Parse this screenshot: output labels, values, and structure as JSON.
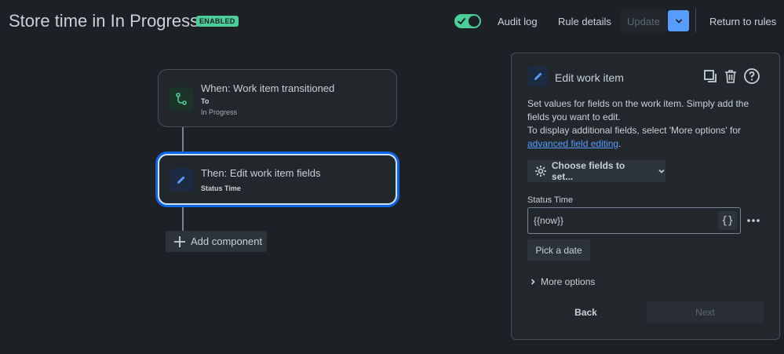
{
  "header": {
    "title": "Store time in In Progress",
    "badge": "ENABLED",
    "audit_log": "Audit log",
    "rule_details": "Rule details",
    "update": "Update",
    "return": "Return to rules"
  },
  "canvas": {
    "trigger": {
      "title": "When: Work item transitioned",
      "sub1": "To",
      "sub2": "In Progress",
      "icon": "transition-icon"
    },
    "action": {
      "title": "Then: Edit work item fields",
      "sub1": "Status Time",
      "icon": "pencil-icon"
    },
    "add_component": "Add component"
  },
  "panel": {
    "title": "Edit work item",
    "desc_line1": "Set values for fields on the work item. Simply add the fields you want to edit.",
    "desc_line2": "To display additional fields, select 'More options' for ",
    "desc_link": "advanced field editing",
    "desc_end": ".",
    "choose_fields": "Choose fields to set...",
    "field_label": "Status Time",
    "field_value": "{{now}}",
    "braces": "{}",
    "pick_date": "Pick a date",
    "more_options": "More options",
    "back": "Back",
    "next": "Next"
  },
  "colors": {
    "background": "#1d2125",
    "accent_blue": "#579dff",
    "enabled_green": "#4bce97"
  }
}
